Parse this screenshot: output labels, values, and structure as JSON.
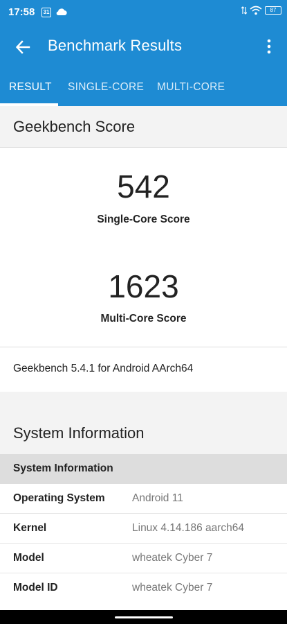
{
  "status_bar": {
    "time": "17:58",
    "calendar_day": "31",
    "battery": "87"
  },
  "app_bar": {
    "title": "Benchmark Results"
  },
  "tabs": [
    {
      "label": "RESULT",
      "active": true
    },
    {
      "label": "SINGLE-CORE",
      "active": false
    },
    {
      "label": "MULTI-CORE",
      "active": false
    }
  ],
  "geekbench": {
    "heading": "Geekbench Score",
    "single_score": "542",
    "single_label": "Single-Core Score",
    "multi_score": "1623",
    "multi_label": "Multi-Core Score",
    "version": "Geekbench 5.4.1 for Android AArch64"
  },
  "system": {
    "heading": "System Information",
    "subheading": "System Information",
    "rows": [
      {
        "key": "Operating System",
        "value": "Android 11"
      },
      {
        "key": "Kernel",
        "value": "Linux 4.14.186 aarch64"
      },
      {
        "key": "Model",
        "value": "wheatek Cyber 7"
      },
      {
        "key": "Model ID",
        "value": "wheatek Cyber 7"
      }
    ]
  },
  "colors": {
    "primary": "#1e8bd3",
    "background": "#f3f3f3"
  }
}
